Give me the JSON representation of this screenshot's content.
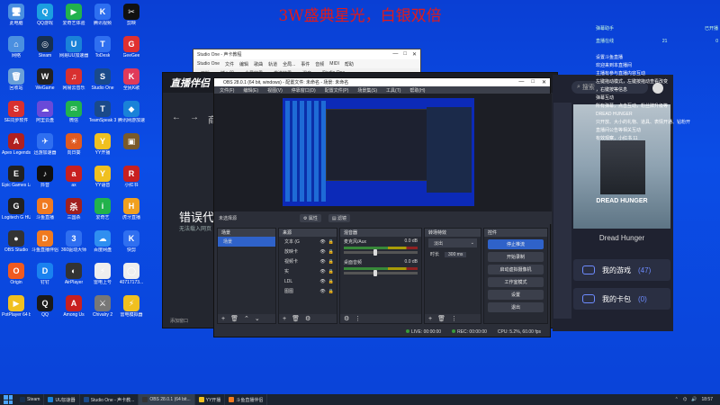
{
  "overlay_title": "3W盛典星光，白银双倍",
  "desktop_icons": [
    {
      "label": "此电脑",
      "color": "#4a8fe0",
      "glyph": "🖥"
    },
    {
      "label": "QQ游戏",
      "color": "#1c9fe0",
      "glyph": "Q"
    },
    {
      "label": "爱奇艺体验",
      "color": "#22b24c",
      "glyph": "▶"
    },
    {
      "label": "腾讯视频",
      "color": "#2d6ff0",
      "glyph": "K"
    },
    {
      "label": "剪映",
      "color": "#111111",
      "glyph": "✂"
    },
    {
      "label": "网络",
      "color": "#4a8fe0",
      "glyph": "⌂"
    },
    {
      "label": "Steam",
      "color": "#17304f",
      "glyph": "◎"
    },
    {
      "label": "网易UU加速器",
      "color": "#1a82d8",
      "glyph": "U"
    },
    {
      "label": "ToDesk",
      "color": "#2f6ff0",
      "glyph": "T"
    },
    {
      "label": "GeeGee",
      "color": "#e03030",
      "glyph": "G"
    },
    {
      "label": "回收站",
      "color": "#6aa0d8",
      "glyph": "🗑"
    },
    {
      "label": "WeGame",
      "color": "#222222",
      "glyph": "W"
    },
    {
      "label": "网易云音乐",
      "color": "#d83030",
      "glyph": "♫"
    },
    {
      "label": "Studio One",
      "color": "#1a4a8a",
      "glyph": "S"
    },
    {
      "label": "全民K歌",
      "color": "#e03a5a",
      "glyph": "K"
    },
    {
      "label": "SE同步软件",
      "color": "#d83030",
      "glyph": "S"
    },
    {
      "label": "阿里云盘",
      "color": "#6a4ad8",
      "glyph": "☁"
    },
    {
      "label": "微信",
      "color": "#22b24c",
      "glyph": "✉"
    },
    {
      "label": "TeamSpeak 3",
      "color": "#1a4a8a",
      "glyph": "T"
    },
    {
      "label": "腾讯网游加速",
      "color": "#1a82d8",
      "glyph": "◆"
    },
    {
      "label": "Apex Legends",
      "color": "#b02020",
      "glyph": "A"
    },
    {
      "label": "迅游加速器",
      "color": "#2f6ff0",
      "glyph": "✈"
    },
    {
      "label": "向日葵",
      "color": "#e05a20",
      "glyph": "☀"
    },
    {
      "label": "YY开播",
      "color": "#f0c020",
      "glyph": "Y"
    },
    {
      "label": "",
      "color": "#7a5a2a",
      "glyph": "▣"
    },
    {
      "label": "Epic Games Launcher",
      "color": "#222222",
      "glyph": "E"
    },
    {
      "label": "抖音",
      "color": "#111111",
      "glyph": "♪"
    },
    {
      "label": "ax",
      "color": "#c82020",
      "glyph": "a"
    },
    {
      "label": "YY语音",
      "color": "#f0c020",
      "glyph": "Y"
    },
    {
      "label": "小红书",
      "color": "#c82020",
      "glyph": "R"
    },
    {
      "label": "Logitech G HUB",
      "color": "#222222",
      "glyph": "G"
    },
    {
      "label": "斗鱼直播",
      "color": "#f07a20",
      "glyph": "D"
    },
    {
      "label": "三国杀",
      "color": "#a02020",
      "glyph": "杀"
    },
    {
      "label": "爱奇艺",
      "color": "#22b24c",
      "glyph": "i"
    },
    {
      "label": "虎牙直播",
      "color": "#f0a020",
      "glyph": "H"
    },
    {
      "label": "OBS Studio",
      "color": "#333333",
      "glyph": "●"
    },
    {
      "label": "斗鱼直播伴侣",
      "color": "#f07a20",
      "glyph": "D"
    },
    {
      "label": "360驱动大师",
      "color": "#2f6ff0",
      "glyph": "3"
    },
    {
      "label": "百度网盘",
      "color": "#2f8ff0",
      "glyph": "☁"
    },
    {
      "label": "快剪",
      "color": "#2f6ff0",
      "glyph": "K"
    },
    {
      "label": "Origin",
      "color": "#f05a20",
      "glyph": "O"
    },
    {
      "label": "钉钉",
      "color": "#1a82f0",
      "glyph": "D"
    },
    {
      "label": "AirPlayer",
      "color": "#333333",
      "glyph": "◐"
    },
    {
      "label": "雷电上号",
      "color": "#eeeeee",
      "glyph": "⚡"
    },
    {
      "label": "40717173...",
      "color": "#eeeeee",
      "glyph": "◯"
    },
    {
      "label": "PotPlayer 64 bit",
      "color": "#f0c020",
      "glyph": "▶"
    },
    {
      "label": "QQ",
      "color": "#1a1a1a",
      "glyph": "Q"
    },
    {
      "label": "Among Us",
      "color": "#c82020",
      "glyph": "A"
    },
    {
      "label": "Chivalry 2",
      "color": "#777777",
      "glyph": "⚔"
    },
    {
      "label": "雷电模拟器",
      "color": "#f0c020",
      "glyph": "⚡"
    }
  ],
  "studio_one": {
    "title": "Studio One - 声卡教程",
    "menu": [
      "Studio One",
      "文件",
      "编辑",
      "歌曲",
      "轨道",
      "全局...",
      "事件",
      "音频",
      "MIDI",
      "帮助"
    ],
    "toolbar": [
      "开始",
      "插入器",
      "全局效果",
      "发送效果",
      "混音",
      "Studio One"
    ]
  },
  "zbl": {
    "logo": "直播伴侣",
    "nav_back": "←",
    "nav_fwd": "→",
    "nav_label": "商店",
    "error_title": "错误代码",
    "error_sub": "无法载入网页",
    "footer": "添加窗口"
  },
  "obs": {
    "title": "OBS 28.0.1 (64 bit, windows) - 配置文件: 未命名 - 场景: 未命名",
    "menu": [
      "文件(F)",
      "编辑(E)",
      "视图(V)",
      "停靠窗口(D)",
      "配置文件(P)",
      "场景集(S)",
      "工具(T)",
      "帮助(H)"
    ],
    "no_source": "未选择源",
    "props_btn": "属性",
    "filters_btn": "滤镜",
    "docks": {
      "scenes": {
        "title": "场景",
        "items": [
          "场景"
        ]
      },
      "sources": {
        "title": "来源",
        "items": [
          "文本 (G",
          "放映卡",
          "视频卡",
          "实",
          "LDL",
          "图图"
        ]
      },
      "mixer": {
        "title": "混音器",
        "rows": [
          {
            "name": "麦克风/Aux",
            "db": "0.0 dB"
          },
          {
            "name": "桌面音频",
            "db": "0.0 dB"
          }
        ]
      },
      "transitions": {
        "title": "转场特效",
        "type": "淡出",
        "duration_label": "时长",
        "duration": "300 ms"
      },
      "controls": {
        "title": "控件",
        "buttons": [
          "停止推流",
          "开始录制",
          "启动虚拟摄像机",
          "工作室模式",
          "设置",
          "退出"
        ]
      }
    },
    "status": {
      "live": "LIVE: 00:00:00",
      "rec": "REC: 00:00:00",
      "cpu": "CPU: 5.2%, 60.00 fps"
    }
  },
  "right_panel": {
    "search_placeholder": "搜索",
    "game_title": "Dread Hunger",
    "game_label": "DREAD HUNGER",
    "my_games_label": "我的游戏",
    "my_games_count": "(47)",
    "my_cards_label": "我的卡包",
    "my_cards_count": "(0)"
  },
  "chat": {
    "top_left": "弹幕助手",
    "top_right": "已开播",
    "row1_left": "直播在线",
    "row1_mid": "21",
    "row1_right": "0",
    "messages": [
      "设置斗鱼直播",
      "欢迎来到本直播间",
      "主播有参与直播内容互动",
      "左键拖动模式，左键按拖动查看改变",
      "，右键按等信息",
      "弹幕互动",
      "所有弹幕，点击互动，粉丝牌升级等",
      "DREAD HUNGER",
      "只开放、大小的礼物、道具、表情开通、钻粉开",
      "直播间公告等相关互动",
      "有效观察，小红书 11"
    ]
  },
  "taskbar": {
    "items": [
      {
        "label": "Steam",
        "color": "#17304f"
      },
      {
        "label": "UU加速器",
        "color": "#1a82d8"
      },
      {
        "label": "Studio One - 声卡教...",
        "color": "#1a4a8a"
      },
      {
        "label": "OBS 28.0.1 (64 bit...",
        "color": "#333333"
      },
      {
        "label": "YY开播",
        "color": "#f0c020"
      },
      {
        "label": "斗鱼直播伴侣",
        "color": "#f07a20"
      }
    ],
    "clock": "18:57"
  }
}
